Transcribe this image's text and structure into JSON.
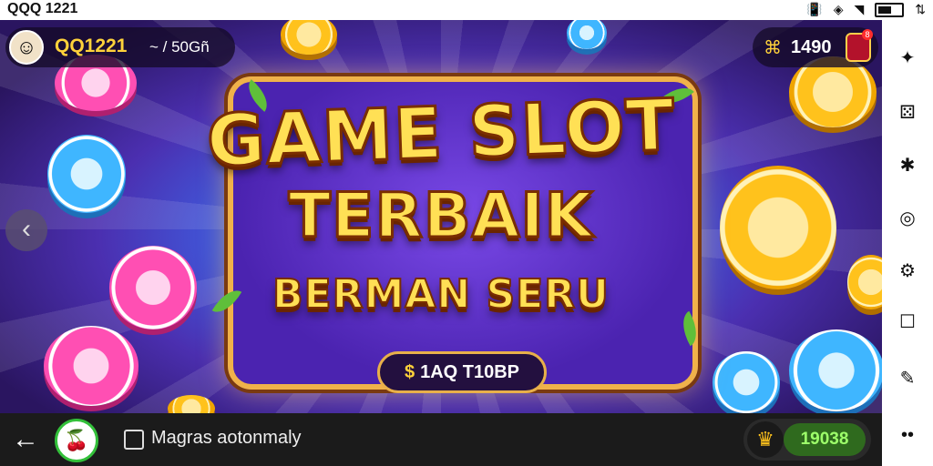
{
  "statusbar": {
    "title": "QQQ 1221",
    "battery_icon": "battery-icon",
    "wifi_icon": "wifi-icon"
  },
  "player": {
    "name": "QQ1221",
    "extra": "~ / 50Gñ",
    "avatar_icon": "avatar-face-icon"
  },
  "coins": {
    "value": "1490",
    "gift_badge": "8"
  },
  "banner": {
    "line1": "GAME SLOT",
    "line2": "TERBAIK",
    "line3": "BERMAN SERU",
    "cta": "1AQ T10BP"
  },
  "bottom": {
    "toggle_label": "Magras aotonmaly",
    "reward_value": "19038"
  },
  "sidebar": {
    "icons": [
      "puzzle-icon",
      "dice-icon",
      "gear-small-icon",
      "headset-icon",
      "settings-icon",
      "square-icon",
      "edit-icon",
      "more-icon"
    ]
  },
  "colors": {
    "accent_gold": "#ffd23a",
    "banner_purple": "#4b23b0",
    "reward_green": "#2f6a1e"
  }
}
